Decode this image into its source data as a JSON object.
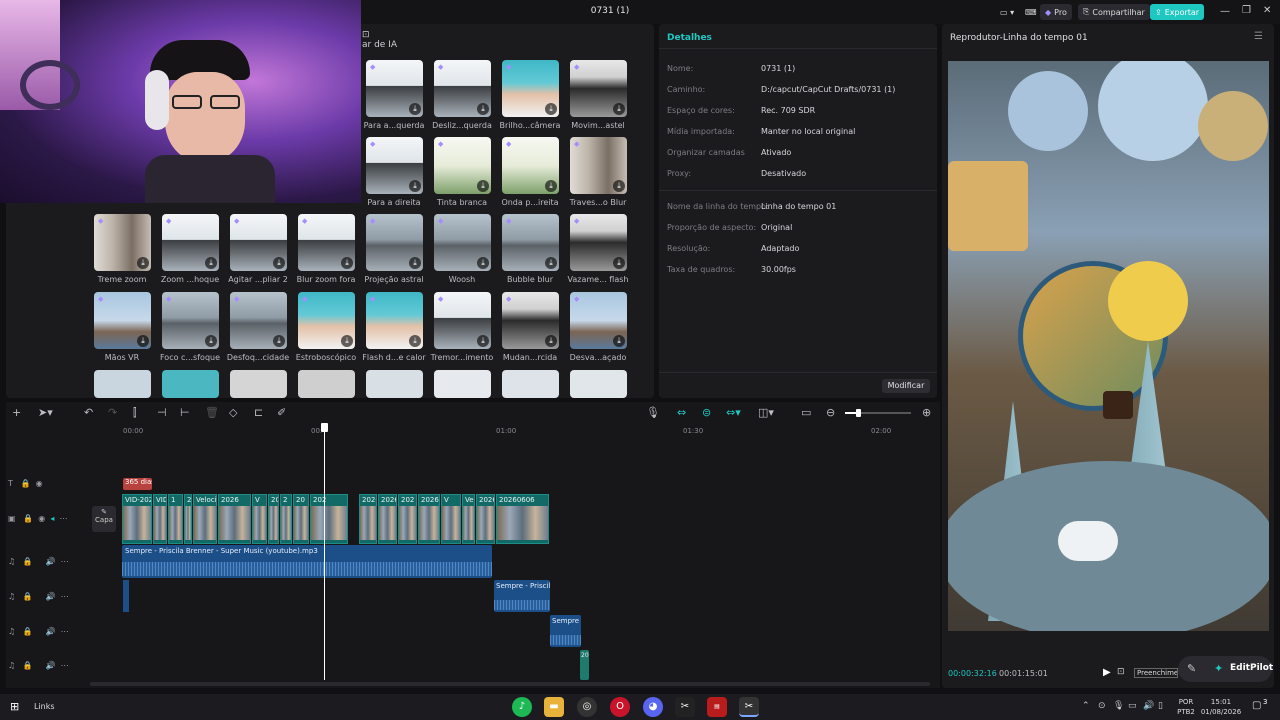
{
  "titlebar": {
    "title": "0731 (1)",
    "pro": "Pro",
    "share": "Compartilhar",
    "export": "Exportar"
  },
  "effects": {
    "tab_fragment": "ar de IA",
    "rows": [
      {
        "items": [
          {
            "label": "Para a...querda",
            "style": "city"
          },
          {
            "label": "Desliz...querda",
            "style": "city"
          },
          {
            "label": "Brilho...câmera",
            "style": "woman"
          },
          {
            "label": "Movim...astel",
            "style": "glasses"
          }
        ]
      },
      {
        "items": [
          {
            "label": "Para a direita",
            "style": "city"
          },
          {
            "label": "Tinta branca",
            "style": "white"
          },
          {
            "label": "Onda p...ireita",
            "style": "white"
          },
          {
            "label": "Traves...o Blur",
            "style": "blur"
          }
        ]
      },
      {
        "items": [
          {
            "label": "Treme zoom",
            "style": "blur"
          },
          {
            "label": "Zoom ...hoque",
            "style": "city"
          },
          {
            "label": "Agitar ...pliar 2",
            "style": "city"
          },
          {
            "label": "Blur zoom fora",
            "style": "city"
          },
          {
            "label": "Projeção astral",
            "style": "car"
          },
          {
            "label": "Woosh",
            "style": "car"
          },
          {
            "label": "Bubble blur",
            "style": "car"
          },
          {
            "label": "Vazame... flash",
            "style": "glasses"
          }
        ]
      },
      {
        "items": [
          {
            "label": "Mãos VR",
            "style": "tower"
          },
          {
            "label": "Foco c...sfoque",
            "style": "car"
          },
          {
            "label": "Desfoq...cidade",
            "style": "car"
          },
          {
            "label": "Estroboscópico",
            "style": "woman"
          },
          {
            "label": "Flash d...e calor",
            "style": "woman"
          },
          {
            "label": "Tremor...imento",
            "style": "city"
          },
          {
            "label": "Mudan...rcida",
            "style": "glasses"
          },
          {
            "label": "Desva...açado",
            "style": "tower"
          }
        ]
      }
    ]
  },
  "details": {
    "header": "Detalhes",
    "rows": [
      {
        "k": "Nome:",
        "v": "0731 (1)"
      },
      {
        "k": "Caminho:",
        "v": "D:/capcut/CapCut Drafts/0731 (1)"
      },
      {
        "k": "Espaço de cores:",
        "v": "Rec. 709 SDR"
      },
      {
        "k": "Mídia importada:",
        "v": "Manter no local original"
      },
      {
        "k": "Organizar camadas",
        "v": "Ativado"
      },
      {
        "k": "Proxy:",
        "v": "Desativado"
      },
      {
        "k": "Nome da linha do tempo:",
        "v": "Linha do tempo 01"
      },
      {
        "k": "Proporção de aspecto:",
        "v": "Original"
      },
      {
        "k": "Resolução:",
        "v": "Adaptado"
      },
      {
        "k": "Taxa de quadros:",
        "v": "30.00fps"
      }
    ],
    "modify": "Modificar"
  },
  "player": {
    "header": "Reprodutor-Linha do tempo 01",
    "current": "00:00:32:16",
    "total": "00:01:15:01",
    "fill": "Preenchimen",
    "editpilot": "EditPilot"
  },
  "timeline": {
    "ruler": [
      "00:00",
      "00:",
      "01:00",
      "01:30",
      "02:00"
    ],
    "text_clip": "365 dias",
    "cover": "Capa",
    "video_clips": [
      {
        "t": "VID-202"
      },
      {
        "t": "VID"
      },
      {
        "t": "1"
      },
      {
        "t": "20"
      },
      {
        "t": "Velocidad"
      },
      {
        "t": "2026"
      },
      {
        "t": "V"
      },
      {
        "t": "2026"
      },
      {
        "t": "2"
      },
      {
        "t": "20"
      },
      {
        "t": "202"
      },
      {
        "t": "20260"
      },
      {
        "t": "2026"
      },
      {
        "t": "202"
      },
      {
        "t": "2026"
      },
      {
        "t": "V"
      },
      {
        "t": "Ve"
      },
      {
        "t": "202606"
      },
      {
        "t": "20260606"
      }
    ],
    "audio": [
      {
        "label": "Sempre - Priscila Brenner - Super Music (youtube).mp3"
      },
      {
        "label": "Sempre - Priscila B"
      },
      {
        "label": "Sempre -"
      },
      {
        "label": "20"
      }
    ]
  },
  "taskbar": {
    "links": "Links",
    "lang": "POR",
    "lang2": "PTB2",
    "time": "15:01",
    "date": "01/08/2026",
    "notif": "3"
  },
  "colors": {
    "accent": "#1fc7c1",
    "clip": "#126a66",
    "audio": "#1c4f88"
  }
}
